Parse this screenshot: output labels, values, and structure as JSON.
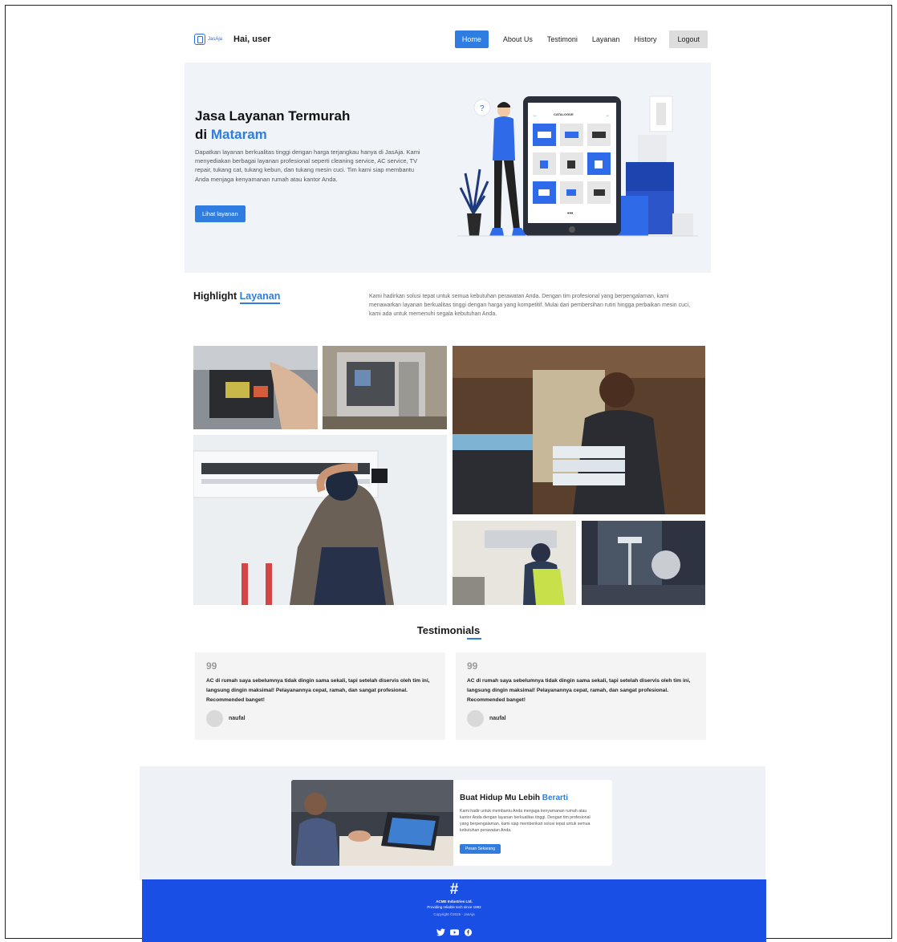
{
  "nav": {
    "logo_text": "JasAja",
    "greeting": "Hai, user",
    "items": [
      {
        "label": "Home",
        "active": true
      },
      {
        "label": "About Us"
      },
      {
        "label": "Testimoni"
      },
      {
        "label": "Layanan"
      },
      {
        "label": "History"
      }
    ],
    "logout": "Logout"
  },
  "hero": {
    "title_line1": "Jasa Layanan Termurah",
    "title_di": "di ",
    "title_highlight": "Mataram",
    "description": "Dapatkan layanan berkualitas tinggi dengan harga terjangkau hanya di JasAja. Kami menyediakan berbagai layanan profesional seperti cleaning service, AC service, TV repair, tukang cat, tukang kebun, dan tukang mesin cuci. Tim kami siap membantu Anda menjaga kenyamanan rumah atau kantor Anda.",
    "button": "Lihat layanan",
    "illustration": {
      "catalogue_label": "CATALOGUE",
      "icon_question": "?",
      "dots": "•••"
    }
  },
  "highlight": {
    "title_plain": "Highlight ",
    "title_highlight": "Layanan",
    "description": "Kami hadirkan solusi tepat untuk semua kebutuhan perawatan Anda. Dengan tim profesional yang berpengalaman, kami menawarkan layanan berkualitas tinggi dengan harga yang kompetitif. Mulai dari pembersihan rutin hingga perbaikan mesin cuci, kami ada untuk memenuhi segala kebutuhan Anda."
  },
  "testimonials": {
    "title": "Testimonials",
    "quote_mark": "99",
    "items": [
      {
        "text": "AC di rumah saya sebelumnya tidak dingin sama sekali, tapi setelah diservis oleh tim ini, langsung dingin maksimal! Pelayanannya cepat, ramah, dan sangat profesional. Recommended banget!",
        "name": "naufal"
      },
      {
        "text": "AC di rumah saya sebelumnya tidak dingin sama sekali, tapi setelah diservis oleh tim ini, langsung dingin maksimal! Pelayanannya cepat, ramah, dan sangat profesional. Recommended banget!",
        "name": "naufal"
      }
    ]
  },
  "cta": {
    "title_plain": "Buat Hidup Mu Lebih ",
    "title_highlight": "Berarti",
    "description": "Kami hadir untuk membantu Anda menjaga kenyamanan rumah atau kantor Anda dengan layanan berkualitas tinggi. Dengan tim profesional yang berpengalaman, kami siap memberikan solusi tepat untuk semua kebutuhan perawatan Anda.",
    "button": "Pesan Sekarang"
  },
  "footer": {
    "logo": "#",
    "company": "ACME Industries Ltd.",
    "tagline": "Providing reliable tech since 1992",
    "copyright": "Copyright ©2025 - JasAja",
    "social": [
      "twitter-icon",
      "youtube-icon",
      "facebook-icon"
    ]
  },
  "colors": {
    "accent": "#2f7de0",
    "footer": "#1a4fe6",
    "hero_bg": "#f0f3f8"
  }
}
